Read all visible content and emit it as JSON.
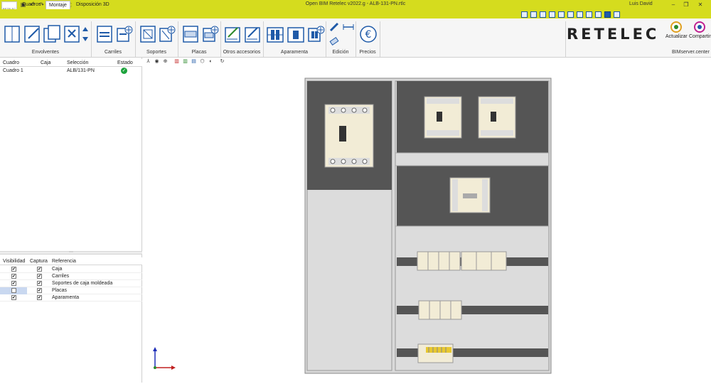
{
  "app": {
    "title": "Open BIM Retelec v2022.g - ALB-131-PN.rtlc",
    "logo_text": "RETELEC",
    "user": "Luis David"
  },
  "tabs": [
    {
      "label": "Cuadros",
      "active": false
    },
    {
      "label": "Montaje",
      "active": true
    },
    {
      "label": "Disposición 3D",
      "active": false
    }
  ],
  "ribbon": {
    "groups": [
      {
        "label": "Envolventes"
      },
      {
        "label": "Carriles"
      },
      {
        "label": "Soportes"
      },
      {
        "label": "Placas"
      },
      {
        "label": "Otros accesorios"
      },
      {
        "label": "Aparamenta"
      },
      {
        "label": "Edición"
      },
      {
        "label": "Precios"
      }
    ],
    "brand": "RETELEC",
    "actualizar": "Actualizar",
    "compartir": "Compartir",
    "bimserver": "BIMserver.center",
    "accent": "#1f5aa8",
    "titlebar_color": "#d5dc1e"
  },
  "boards_table": {
    "headers": [
      "Cuadro",
      "Caja",
      "Selección",
      "Estado"
    ],
    "rows": [
      {
        "cuadro": "Cuadro 1",
        "caja": "",
        "seleccion": "ALB/131-PN",
        "estado": "ok"
      }
    ]
  },
  "layers_table": {
    "headers": [
      "Visibilidad",
      "Captura",
      "Referencia"
    ],
    "rows": [
      {
        "visible": true,
        "capture": true,
        "ref": "Caja"
      },
      {
        "visible": true,
        "capture": true,
        "ref": "Carriles"
      },
      {
        "visible": true,
        "capture": true,
        "ref": "Soportes de caja moldeada"
      },
      {
        "visible": false,
        "capture": true,
        "ref": "Placas"
      },
      {
        "visible": true,
        "capture": true,
        "ref": "Aparamenta"
      }
    ]
  }
}
